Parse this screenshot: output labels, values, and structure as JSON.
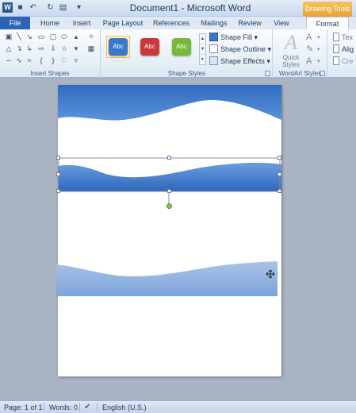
{
  "titlebar": {
    "app_icon": "W",
    "title": "Document1 - Microsoft Word",
    "context_tab": "Drawing Tools",
    "qat": {
      "save_icon": "save-icon",
      "undo_icon": "undo-icon",
      "redo_icon": "redo-icon",
      "customize_icon": "customize-qat-icon"
    }
  },
  "tabs": [
    "File",
    "Home",
    "Insert",
    "Page Layout",
    "References",
    "Mailings",
    "Review",
    "View",
    "Format"
  ],
  "ribbon": {
    "insert_shapes": {
      "label": "Insert Shapes"
    },
    "shape_styles": {
      "label": "Shape Styles",
      "swatches": [
        {
          "text": "Abc",
          "color": "#3a78c8"
        },
        {
          "text": "Abc",
          "color": "#c83a3a"
        },
        {
          "text": "Abc",
          "color": "#7ab83a"
        }
      ],
      "shape_fill": "Shape Fill",
      "shape_outline": "Shape Outline",
      "shape_effects": "Shape Effects"
    },
    "wordart_styles": {
      "label": "WordArt Styles",
      "quick_styles": "Quick Styles",
      "big_letter": "A"
    },
    "text": {
      "text_label": "Tex",
      "align_label": "Alig",
      "create_label": "Cre"
    }
  },
  "status": {
    "page": "Page: 1 of 1",
    "words": "Words: 0",
    "language": "English (U.S.)"
  },
  "colors": {
    "accent_blue": "#3a78c8",
    "wave_light": "#8fb0dd",
    "selection_handle": "#6e7f96",
    "rotation_handle": "#8cc44a"
  }
}
